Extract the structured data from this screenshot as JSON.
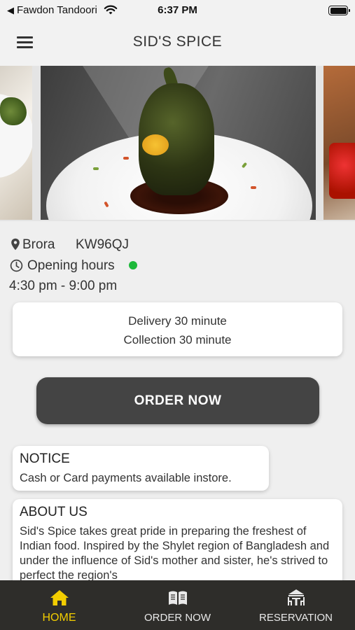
{
  "status_bar": {
    "back_arrow": "◀",
    "carrier": "Fawdon Tandoori",
    "time": "6:37 PM"
  },
  "nav": {
    "title": "SID'S SPICE",
    "menu_icon": "hamburger-menu-icon"
  },
  "carousel": {
    "image_count_visible": 3
  },
  "info": {
    "location": "Brora",
    "postcode": "KW96QJ",
    "hours_label": "Opening hours",
    "open_status_color": "#1db93a",
    "hours": "4:30 pm - 9:00 pm"
  },
  "times": {
    "delivery": "Delivery 30 minute",
    "collection": "Collection 30 minute"
  },
  "order_button": {
    "label": "ORDER NOW"
  },
  "notice": {
    "heading": "NOTICE",
    "text": "Cash or Card payments available instore."
  },
  "about": {
    "heading": "ABOUT US",
    "text": "Sid's Spice takes great pride in preparing the freshest of Indian food. Inspired by the Shylet region of Bangladesh and under the influence of Sid's mother and sister, he's strived to perfect the region's"
  },
  "tabs": [
    {
      "label": "HOME",
      "icon": "home-icon",
      "active": true
    },
    {
      "label": "ORDER NOW",
      "icon": "menu-book-icon",
      "active": false
    },
    {
      "label": "RESERVATION",
      "icon": "restaurant-table-icon",
      "active": false
    }
  ],
  "colors": {
    "accent_active_tab": "#f2cd00",
    "tab_bar_bg": "#2e2d2a",
    "button_bg": "#444444"
  }
}
